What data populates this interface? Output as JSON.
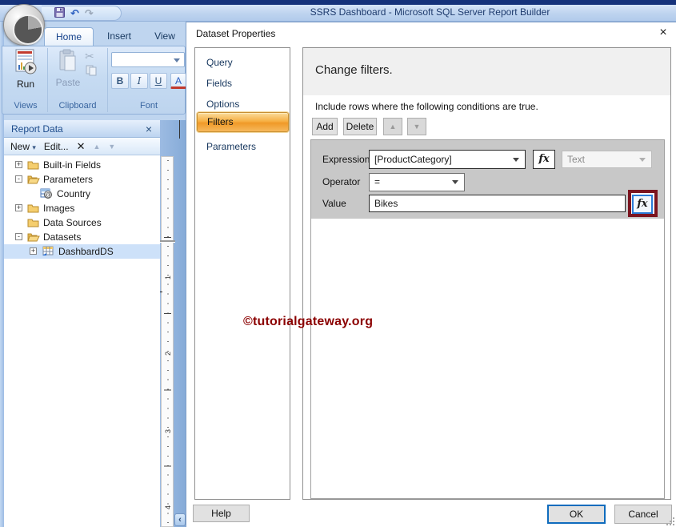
{
  "window": {
    "title": "SSRS Dashboard - Microsoft SQL Server Report Builder"
  },
  "ribbon": {
    "tabs": [
      {
        "label": "Home",
        "active": true
      },
      {
        "label": "Insert",
        "active": false
      },
      {
        "label": "View",
        "active": false
      }
    ],
    "run_label": "Run",
    "paste_label": "Paste",
    "group_labels": [
      "Views",
      "Clipboard",
      "Font"
    ],
    "font_buttons": {
      "bold": "B",
      "italic": "I",
      "underline": "U",
      "color": "A"
    }
  },
  "report_data": {
    "title": "Report Data",
    "toolbar": {
      "new_label": "New",
      "new_caret": "▾",
      "edit_label": "Edit...",
      "delete_glyph": "✕",
      "up_glyph": "▲",
      "down_glyph": "▼"
    },
    "tree": [
      {
        "label": "Built-in Fields",
        "expander": "+"
      },
      {
        "label": "Parameters",
        "expander": "-"
      },
      {
        "label": "Country",
        "expander": ""
      },
      {
        "label": "Images",
        "expander": "+"
      },
      {
        "label": "Data Sources",
        "expander": ""
      },
      {
        "label": "Datasets",
        "expander": "-"
      },
      {
        "label": "DashbardDS",
        "expander": "+"
      }
    ]
  },
  "ruler": {
    "labels": [
      "1",
      "2",
      "3",
      "4"
    ]
  },
  "dialog": {
    "title": "Dataset Properties",
    "close_glyph": "×",
    "nav": [
      {
        "label": "Query"
      },
      {
        "label": "Fields"
      },
      {
        "label": "Options"
      },
      {
        "label": "Filters",
        "selected": true
      },
      {
        "label": "Parameters"
      }
    ],
    "header": "Change filters.",
    "instruction": "Include rows where the following conditions are true.",
    "toolbar": {
      "add": "Add",
      "delete": "Delete",
      "up_glyph": "▲",
      "down_glyph": "▼"
    },
    "filter": {
      "expression_label": "Expression",
      "expression_value": "[ProductCategory]",
      "type_value": "Text",
      "operator_label": "Operator",
      "operator_value": "=",
      "value_label": "Value",
      "value_text": "Bikes",
      "fx_label": "fx"
    },
    "buttons": {
      "help": "Help",
      "ok": "OK",
      "cancel": "Cancel"
    }
  },
  "watermark": "©tutorialgateway.org",
  "colors": {
    "accent_orange": "#f6b044",
    "annotation_maroon": "#7b141f",
    "watermark_red": "#8b0000",
    "ok_border_blue": "#0f6cbd",
    "tree_selection_blue": "#cde1f9",
    "titlebar_blue": "#bcd2ee"
  }
}
